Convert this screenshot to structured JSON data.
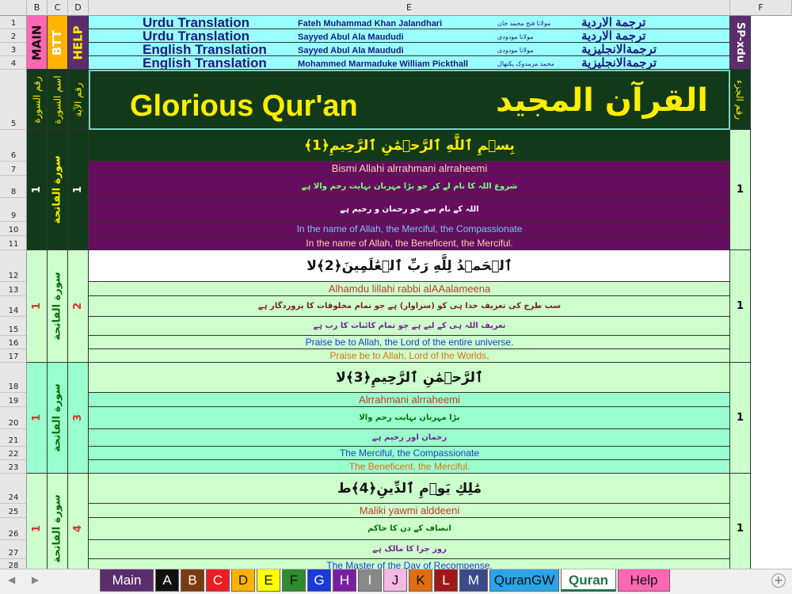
{
  "columns": [
    "B",
    "C",
    "D",
    "E",
    "F"
  ],
  "rows": [
    "1",
    "2",
    "3",
    "4",
    "5",
    "6",
    "7",
    "8",
    "9",
    "10",
    "11",
    "12",
    "13",
    "14",
    "15",
    "16",
    "17",
    "18",
    "19",
    "20",
    "21",
    "22",
    "23",
    "24",
    "25",
    "26",
    "27",
    "28"
  ],
  "buttons": {
    "main": "MAIN",
    "btt": "BTT",
    "help": "HELP",
    "sp_xdu": "SP-xdu"
  },
  "header_lines": [
    {
      "english": "Urdu Translation",
      "translator": "Fateh Muhammad Khan Jalandhari",
      "urdu_name": "مولانا فتح محمد خان",
      "arabic": "ترجمة الاردية"
    },
    {
      "english": "Urdu Translation",
      "translator": "Sayyed Abul Ala Maududi",
      "urdu_name": "مولانا مودودی",
      "arabic": "ترجمة الاردية"
    },
    {
      "english": "English Translation",
      "translator": "Sayyed Abul Ala Maududi",
      "urdu_name": "مولانا مودودی",
      "arabic": "ترجمةالانجليزية"
    },
    {
      "english": "English Translation",
      "translator": "Mohammed Marmaduke William Pickthall",
      "urdu_name": "محمد مرمدوک پکتھال",
      "arabic": "ترجمةالانجليزية"
    }
  ],
  "col_headers": {
    "surah_no": "رقم السورة",
    "surah_name": "اسم السورة",
    "ayah_no": "رقم الآية",
    "juz_no": "رقم الجزء"
  },
  "title": {
    "english": "Glorious Qur'an",
    "arabic": "القرآن المجيد"
  },
  "verses": [
    {
      "surah_no": "1",
      "surah_name": "سورة الفاتحة",
      "ayah_no": "1",
      "juz": "1",
      "arabic": "بِسۡمِ ٱللَّهِ ٱلرَّحۡمَٰنِ ٱلرَّحِيمِ﴿1﴾",
      "translit": "Bismi Allahi alrrahmani alrraheemi",
      "urdu1": "شروع اللہ کا نام لے کر جو بڑا مہربان نہایت رحم والا ہے",
      "urdu2": "اللہ کے نام سے جو رحمان و رحیم ہے",
      "english1": "In the name of Allah, the Merciful, the Compassionate",
      "english2": "In the name of Allah, the Beneficent, the Merciful."
    },
    {
      "surah_no": "1",
      "surah_name": "سورة الفاتحة",
      "ayah_no": "2",
      "juz": "1",
      "arabic": "ٱلۡحَمۡدُ لِلَّهِ رَبِّ ٱلۡعَٰلَمِينَ﴿2﴾لا",
      "translit": "Alhamdu lillahi rabbi alAAalameena",
      "urdu1": "سب طرح کی تعریف خدا ہی کو (سزاوار) ہے جو تمام مخلوقات کا پروردگار ہے",
      "urdu2": "تعریف اللہ ہی کے لیے ہے جو تمام کائنات کا رب ہے",
      "english1": "Praise be to Allah, the Lord of the entire universe.",
      "english2": "Praise be to Allah, Lord of the Worlds,"
    },
    {
      "surah_no": "1",
      "surah_name": "سورة الفاتحة",
      "ayah_no": "3",
      "juz": "1",
      "arabic": "ٱلرَّحۡمَٰنِ ٱلرَّحِيمِ﴿3﴾لا",
      "translit": "Alrrahmani alrraheemi",
      "urdu1": "بڑا مہربان نہایت رحم والا",
      "urdu2": "رحمان اور رحیم ہے",
      "english1": "The Merciful, the Compassionate",
      "english2": "The Beneficent, the Merciful."
    },
    {
      "surah_no": "1",
      "surah_name": "سورة الفاتحة",
      "ayah_no": "4",
      "juz": "1",
      "arabic": "مَٰلِكِ يَوۡمِ ٱلدِّينِ﴿4﴾ط",
      "translit": "Maliki yawmi alddeeni",
      "urdu1": "انصاف کے دن کا حاکم",
      "urdu2": "روز جزا کا مالک ہے",
      "english1": "The Master of the Day of Recompense.",
      "english2": ""
    }
  ],
  "tabs": [
    {
      "label": "Main",
      "bg": "#5c2d6e",
      "fg": "#ffffff"
    },
    {
      "label": "A",
      "bg": "#111111",
      "fg": "#ffffff"
    },
    {
      "label": "B",
      "bg": "#7a3b10",
      "fg": "#ffffff"
    },
    {
      "label": "C",
      "bg": "#ee1c24",
      "fg": "#ffffff"
    },
    {
      "label": "D",
      "bg": "#ffb300",
      "fg": "#111111"
    },
    {
      "label": "E",
      "bg": "#ffff00",
      "fg": "#111111"
    },
    {
      "label": "F",
      "bg": "#2e8b2e",
      "fg": "#111111"
    },
    {
      "label": "G",
      "bg": "#1a3bd6",
      "fg": "#ffffff"
    },
    {
      "label": "H",
      "bg": "#7b1fa2",
      "fg": "#ffffff"
    },
    {
      "label": "I",
      "bg": "#888888",
      "fg": "#ffffff"
    },
    {
      "label": "J",
      "bg": "#f4b8e4",
      "fg": "#111111"
    },
    {
      "label": "K",
      "bg": "#e06d10",
      "fg": "#111111"
    },
    {
      "label": "L",
      "bg": "#a01818",
      "fg": "#ffffff"
    },
    {
      "label": "M",
      "bg": "#3a4a8a",
      "fg": "#ffffff"
    },
    {
      "label": "QuranGW",
      "bg": "#2aa4e8",
      "fg": "#111111"
    },
    {
      "label": "Quran",
      "bg": "#ffffff",
      "fg": "#217346"
    },
    {
      "label": "Help",
      "bg": "#ff66b3",
      "fg": "#111111"
    }
  ],
  "active_tab": "Quran",
  "colors": {
    "header_bg": "#99ffff",
    "title_bg": "#123a1a",
    "verse1_bg": "#660d5f",
    "verse_light": "#ccffcc",
    "verse_teal": "#99ffcc"
  }
}
